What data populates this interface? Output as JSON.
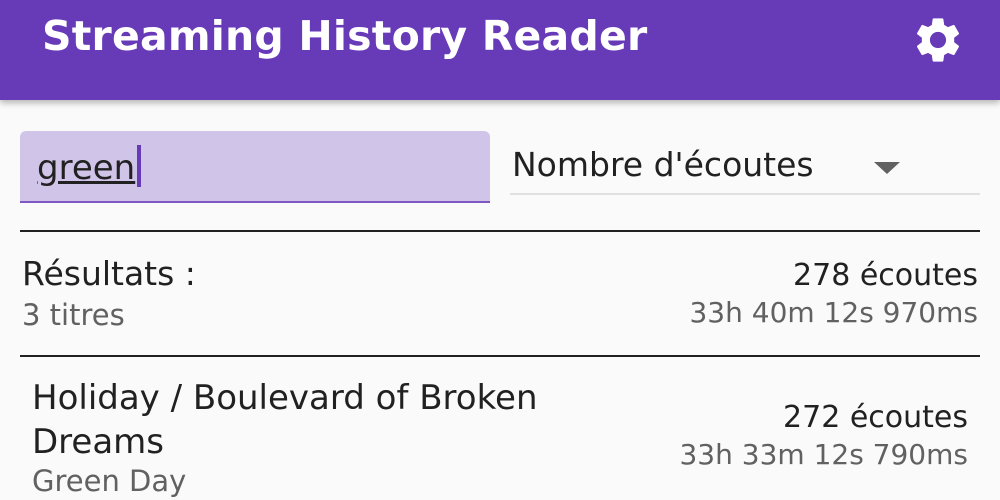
{
  "appbar": {
    "title": "Streaming History Reader",
    "settings_icon": "gear-icon",
    "color": "#673ab7"
  },
  "search": {
    "value": "green",
    "field_color": "#d1c4e9"
  },
  "sort": {
    "selected": "Nombre d'écoutes",
    "icon": "chevron-down-icon"
  },
  "summary": {
    "title": "Résultats :",
    "subtitle": "3 titres",
    "count": "278 écoutes",
    "duration": "33h 40m 12s 970ms"
  },
  "results": [
    {
      "title": "Holiday / Boulevard of Broken Dreams",
      "artist": "Green Day",
      "count": "272 écoutes",
      "duration": "33h 33m 12s 790ms"
    }
  ]
}
